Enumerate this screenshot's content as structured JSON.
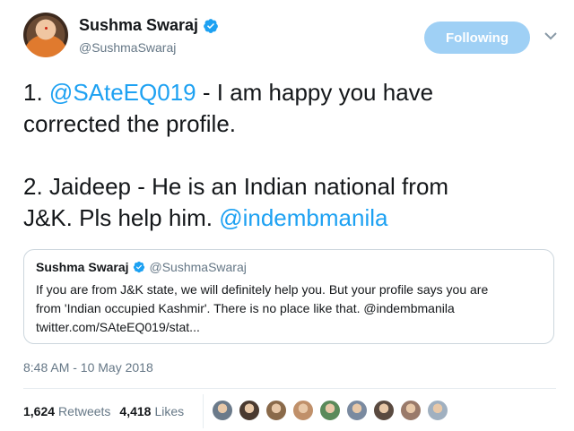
{
  "author": {
    "name": "Sushma Swaraj",
    "handle": "@SushmaSwaraj",
    "verified_icon": "verified-badge-icon"
  },
  "follow_button": {
    "label": "Following",
    "color": "#9fd0f5"
  },
  "tweet": {
    "line1_prefix": "1. ",
    "line1_mention": "@SAteEQ019",
    "line1_text": " - I am happy you have",
    "line2_text": "corrected the profile.",
    "line3_text": "2. Jaideep - He is an Indian national from",
    "line4_text": "J&K. Pls help him. ",
    "line4_mention": "@indembmanila"
  },
  "quote": {
    "name": "Sushma Swaraj",
    "handle": "@SushmaSwaraj",
    "line1": "If you are from J&K state, we will definitely help you. But your profile says you are",
    "line2": "from 'Indian occupied Kashmir'. There is no place like that. @indembmanila",
    "line3": "twitter.com/SAteEQ019/stat..."
  },
  "timestamp": "8:48 AM - 10 May 2018",
  "stats": {
    "retweets_count": "1,624",
    "retweets_label": "Retweets",
    "likes_count": "4,418",
    "likes_label": "Likes"
  },
  "likers": [
    "#6b7a8a",
    "#4a3a30",
    "#8a6a4a",
    "#c0906a",
    "#5a8a5a",
    "#7a8aa0",
    "#5a4a40",
    "#9a7a6a",
    "#a0b0c0"
  ],
  "colors": {
    "accent": "#1da1f2",
    "muted": "#657786",
    "text": "#14171a"
  }
}
